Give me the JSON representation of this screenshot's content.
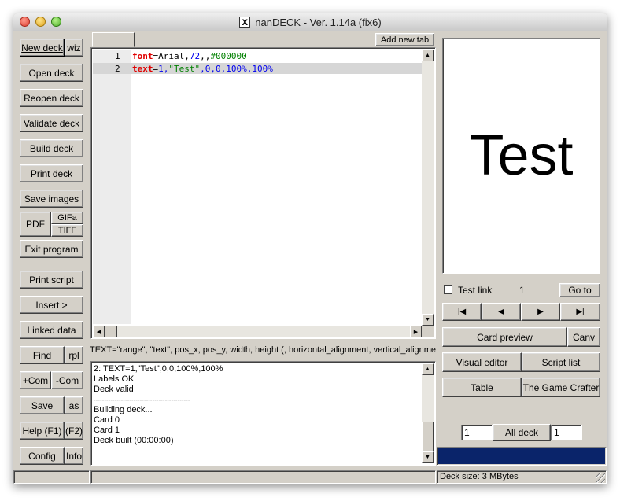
{
  "window": {
    "title": "nanDECK - Ver. 1.14a (fix6)",
    "x_icon": "X"
  },
  "left_buttons": {
    "new_deck": "New deck",
    "wiz": "wiz",
    "open_deck": "Open deck",
    "reopen_deck": "Reopen deck",
    "validate_deck": "Validate deck",
    "build_deck": "Build deck",
    "print_deck": "Print deck",
    "save_images": "Save images",
    "pdf": "PDF",
    "gifa": "GIFa",
    "tiff": "TIFF",
    "exit_program": "Exit program",
    "print_script": "Print script",
    "insert": "Insert >",
    "linked_data": "Linked data",
    "find": "Find",
    "rpl": "rpl",
    "com_add": "+Com",
    "com_remove": "-Com",
    "save": "Save",
    "as": "as",
    "help": "Help (F1)",
    "f2": "(F2)",
    "config": "Config",
    "info": "Info"
  },
  "editor": {
    "add_tab": "Add new tab",
    "lines": [
      {
        "num": "1",
        "kw": "font",
        "eq": "=",
        "a": "Arial,",
        "b": "72",
        "c": ",,",
        "d": "#000000"
      },
      {
        "num": "2",
        "kw": "text",
        "eq": "=",
        "a": "1,",
        "b": "\"Test\"",
        "c": ",0,0,",
        "d": "100%,100%"
      }
    ],
    "hint": "TEXT=\"range\", \"text\", pos_x, pos_y, width, height (, horizontal_alignment, vertical_alignment,"
  },
  "log": {
    "lines": [
      "2: TEXT=1,\"Test\",0,0,100%,100%",
      "Labels OK",
      "Deck valid",
      "----------------------------------------------",
      "Building deck...",
      "Card 0",
      "Card 1",
      "Deck built (00:00:00)"
    ]
  },
  "preview": {
    "card_text": "Test",
    "test_link_label": "Test link",
    "card_number": "1",
    "go_to": "Go to",
    "nav": {
      "first": "|◀",
      "prev": "◀",
      "next": "▶",
      "last": "▶|"
    },
    "card_preview": "Card preview",
    "canv": "Canv",
    "visual_editor": "Visual editor",
    "script_list": "Script list",
    "table": "Table",
    "game_crafter": "The Game Crafter",
    "range_from": "1",
    "all_deck": "All deck",
    "range_to": "1"
  },
  "status": {
    "deck_size": "Deck size: 3 MBytes"
  },
  "colors": {
    "progress": "#0a246a",
    "keyword": "#e00000",
    "number": "#0000ee",
    "string": "#008000"
  }
}
